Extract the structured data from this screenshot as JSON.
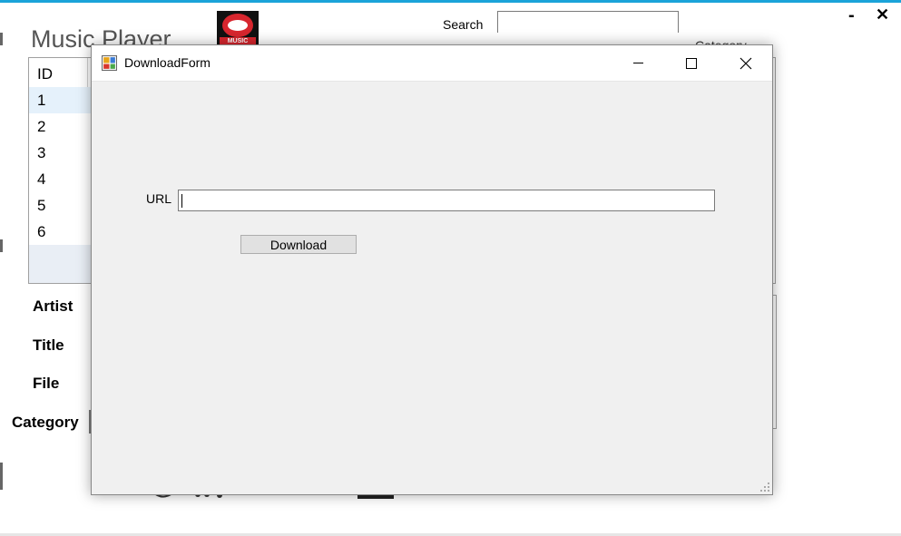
{
  "app": {
    "title": "Music Player",
    "logo_text": "MUSIC",
    "search_label": "Search",
    "search_value": "",
    "category_partial": "Category",
    "minimize_glyph": "-",
    "close_glyph": "✕"
  },
  "list": {
    "header": "ID",
    "rows": [
      "1",
      "2",
      "3",
      "4",
      "5",
      "6"
    ]
  },
  "details": {
    "artist_label": "Artist",
    "title_label": "Title",
    "file_label": "File",
    "category_label": "Category"
  },
  "dialog": {
    "title": "DownloadForm",
    "url_label": "URL",
    "url_value": "",
    "download_label": "Download"
  },
  "colors": {
    "accent": "#1aa3d9",
    "logo_red": "#d7262e",
    "dialog_bg": "#f0f0f0",
    "button_bg": "#e1e1e1"
  }
}
